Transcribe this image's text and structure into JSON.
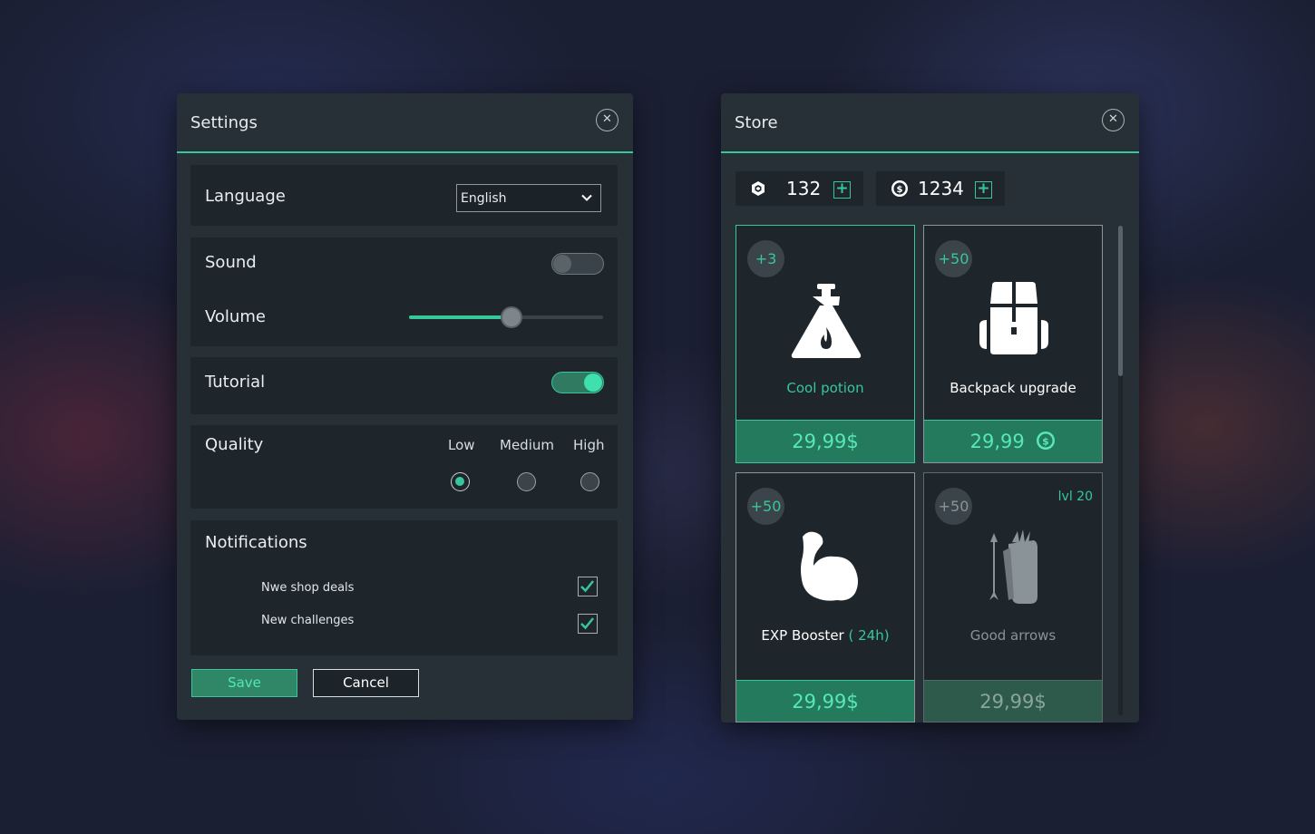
{
  "settings": {
    "title": "Settings",
    "language": {
      "label": "Language",
      "value": "English"
    },
    "sound": {
      "label": "Sound",
      "enabled": false
    },
    "volume": {
      "label": "Volume",
      "level_percent": 53
    },
    "tutorial": {
      "label": "Tutorial",
      "enabled": true
    },
    "quality": {
      "label": "Quality",
      "options": [
        "Low",
        "Medium",
        "High"
      ],
      "selected": "Low"
    },
    "notifications": {
      "label": "Notifications",
      "items": [
        {
          "label": "Nwe shop deals",
          "checked": true
        },
        {
          "label": "New challenges",
          "checked": true
        }
      ]
    },
    "save_label": "Save",
    "cancel_label": "Cancel"
  },
  "store": {
    "title": "Store",
    "gems": {
      "value": "132",
      "icon": "gem-icon"
    },
    "coins": {
      "value": "1234",
      "icon": "coin-icon"
    },
    "items": [
      {
        "badge": "+3",
        "name": "Cool potion",
        "price": "29,99$",
        "icon": "potion-icon"
      },
      {
        "badge": "+50",
        "name": "Backpack  upgrade",
        "price": "29,99",
        "icon": "backpack-icon",
        "price_icon": "coin-icon"
      },
      {
        "badge": "+50",
        "name": "EXP Booster",
        "name_suffix": "( 24h)",
        "price": "29,99$",
        "icon": "muscle-icon"
      },
      {
        "badge": "+50",
        "lvl": "lvl 20",
        "name": "Good arrows",
        "price": "29,99$",
        "icon": "quiver-icon"
      }
    ]
  },
  "colors": {
    "accent": "#37c79a",
    "panel": "#273037",
    "section": "#1e262c"
  }
}
